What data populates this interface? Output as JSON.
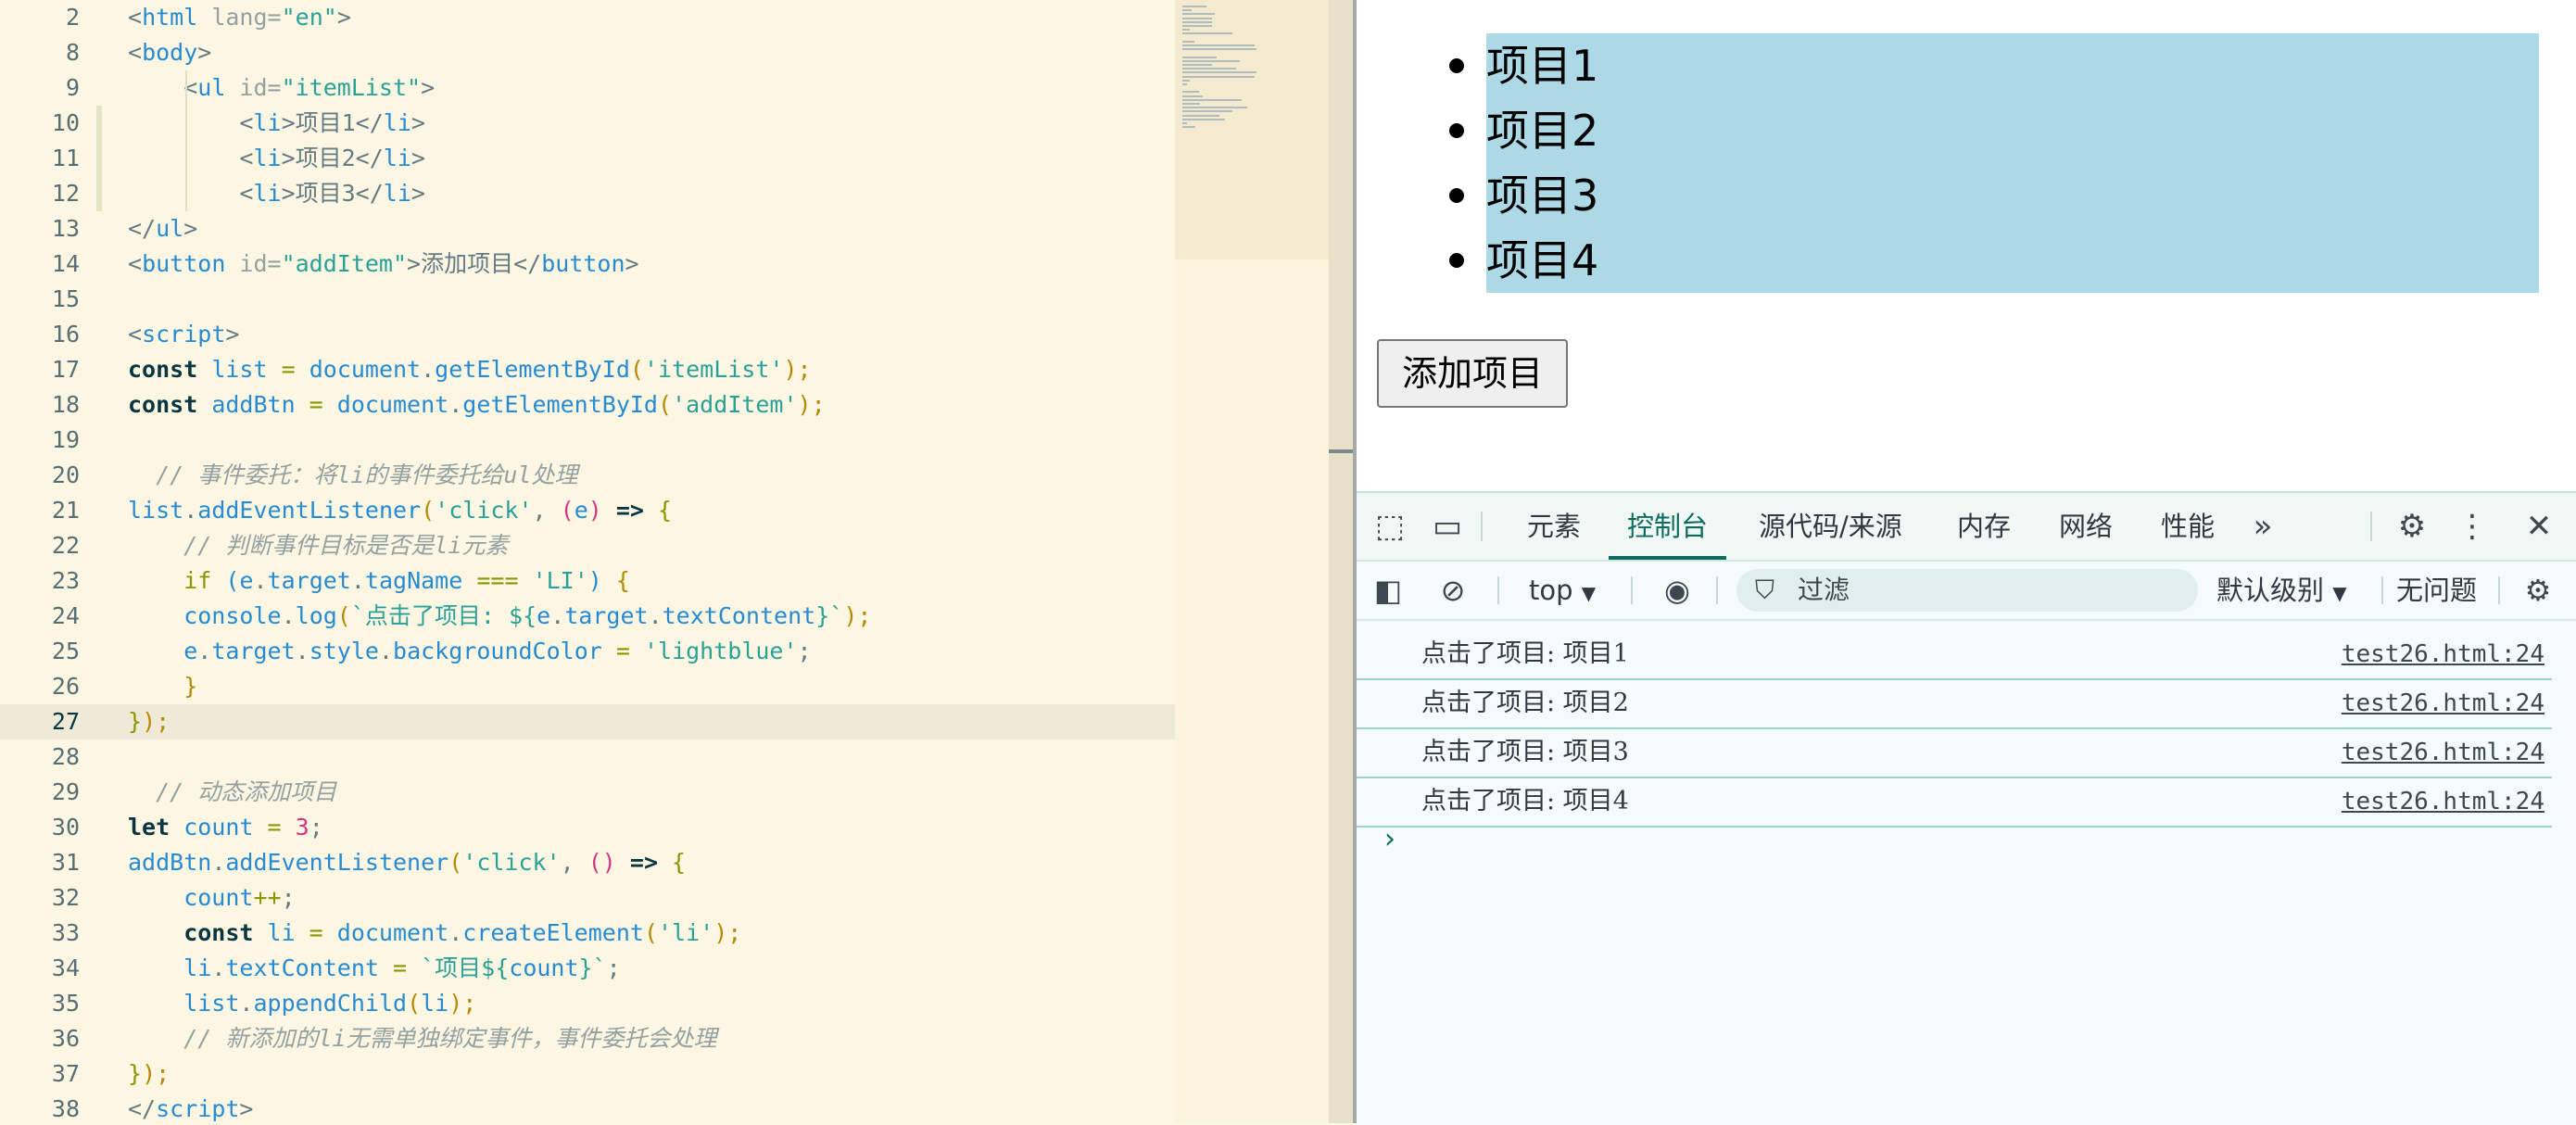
{
  "editor": {
    "lines": [
      {
        "num": "2",
        "segments": [
          {
            "t": "<",
            "c": "t-p"
          },
          {
            "t": "html ",
            "c": "t-tag"
          },
          {
            "t": "lang=",
            "c": "t-attr"
          },
          {
            "t": "\"en\"",
            "c": "t-str"
          },
          {
            "t": ">",
            "c": "t-p"
          }
        ]
      },
      {
        "num": "8",
        "segments": [
          {
            "t": "<",
            "c": "t-p"
          },
          {
            "t": "body",
            "c": "t-tag"
          },
          {
            "t": ">",
            "c": "t-p"
          }
        ]
      },
      {
        "num": "9",
        "segments": [
          {
            "t": "    <",
            "c": "t-p"
          },
          {
            "t": "ul ",
            "c": "t-tag"
          },
          {
            "t": "id=",
            "c": "t-attr"
          },
          {
            "t": "\"itemList\"",
            "c": "t-str"
          },
          {
            "t": ">",
            "c": "t-p"
          }
        ]
      },
      {
        "num": "10",
        "segments": [
          {
            "t": "        <",
            "c": "t-p"
          },
          {
            "t": "li",
            "c": "t-tag"
          },
          {
            "t": ">项目1</",
            "c": "t-p"
          },
          {
            "t": "li",
            "c": "t-tag"
          },
          {
            "t": ">",
            "c": "t-p"
          }
        ]
      },
      {
        "num": "11",
        "segments": [
          {
            "t": "        <",
            "c": "t-p"
          },
          {
            "t": "li",
            "c": "t-tag"
          },
          {
            "t": ">项目2</",
            "c": "t-p"
          },
          {
            "t": "li",
            "c": "t-tag"
          },
          {
            "t": ">",
            "c": "t-p"
          }
        ]
      },
      {
        "num": "12",
        "segments": [
          {
            "t": "        <",
            "c": "t-p"
          },
          {
            "t": "li",
            "c": "t-tag"
          },
          {
            "t": ">项目3</",
            "c": "t-p"
          },
          {
            "t": "li",
            "c": "t-tag"
          },
          {
            "t": ">",
            "c": "t-p"
          }
        ]
      },
      {
        "num": "13",
        "segments": [
          {
            "t": "</",
            "c": "t-p"
          },
          {
            "t": "ul",
            "c": "t-tag"
          },
          {
            "t": ">",
            "c": "t-p"
          }
        ]
      },
      {
        "num": "14",
        "segments": [
          {
            "t": "<",
            "c": "t-p"
          },
          {
            "t": "button ",
            "c": "t-tag"
          },
          {
            "t": "id=",
            "c": "t-attr"
          },
          {
            "t": "\"addItem\"",
            "c": "t-str"
          },
          {
            "t": ">添加项目</",
            "c": "t-p"
          },
          {
            "t": "button",
            "c": "t-tag"
          },
          {
            "t": ">",
            "c": "t-p"
          }
        ]
      },
      {
        "num": "15",
        "segments": []
      },
      {
        "num": "16",
        "segments": [
          {
            "t": "<",
            "c": "t-p"
          },
          {
            "t": "script",
            "c": "t-tag"
          },
          {
            "t": ">",
            "c": "t-p"
          }
        ]
      },
      {
        "num": "17",
        "segments": [
          {
            "t": "const ",
            "c": "t-kw"
          },
          {
            "t": "list ",
            "c": "t-var"
          },
          {
            "t": "= ",
            "c": "t-op"
          },
          {
            "t": "document",
            "c": "t-var"
          },
          {
            "t": ".",
            "c": "t-p"
          },
          {
            "t": "getElementById",
            "c": "t-var"
          },
          {
            "t": "(",
            "c": "t-br1"
          },
          {
            "t": "'itemList'",
            "c": "t-str"
          },
          {
            "t": ");",
            "c": "t-br1"
          }
        ]
      },
      {
        "num": "18",
        "segments": [
          {
            "t": "const ",
            "c": "t-kw"
          },
          {
            "t": "addBtn ",
            "c": "t-var"
          },
          {
            "t": "= ",
            "c": "t-op"
          },
          {
            "t": "document",
            "c": "t-var"
          },
          {
            "t": ".",
            "c": "t-p"
          },
          {
            "t": "getElementById",
            "c": "t-var"
          },
          {
            "t": "(",
            "c": "t-br1"
          },
          {
            "t": "'addItem'",
            "c": "t-str"
          },
          {
            "t": ");",
            "c": "t-br1"
          }
        ]
      },
      {
        "num": "19",
        "segments": []
      },
      {
        "num": "20",
        "segments": [
          {
            "t": "  // 事件委托：将li的事件委托给ul处理",
            "c": "t-com"
          }
        ]
      },
      {
        "num": "21",
        "segments": [
          {
            "t": "list",
            "c": "t-var"
          },
          {
            "t": ".",
            "c": "t-p"
          },
          {
            "t": "addEventListener",
            "c": "t-var"
          },
          {
            "t": "(",
            "c": "t-br1"
          },
          {
            "t": "'click'",
            "c": "t-str"
          },
          {
            "t": ", ",
            "c": "t-p"
          },
          {
            "t": "(",
            "c": "t-br2"
          },
          {
            "t": "e",
            "c": "t-var"
          },
          {
            "t": ") ",
            "c": "t-br2"
          },
          {
            "t": "=> ",
            "c": "t-kw"
          },
          {
            "t": "{",
            "c": "t-op"
          }
        ]
      },
      {
        "num": "22",
        "segments": [
          {
            "t": "    // 判断事件目标是否是li元素",
            "c": "t-com"
          }
        ]
      },
      {
        "num": "23",
        "segments": [
          {
            "t": "    if ",
            "c": "t-if"
          },
          {
            "t": "(",
            "c": "t-br3"
          },
          {
            "t": "e",
            "c": "t-var"
          },
          {
            "t": ".",
            "c": "t-p"
          },
          {
            "t": "target",
            "c": "t-var"
          },
          {
            "t": ".",
            "c": "t-p"
          },
          {
            "t": "tagName ",
            "c": "t-var"
          },
          {
            "t": "=== ",
            "c": "t-op"
          },
          {
            "t": "'LI'",
            "c": "t-str"
          },
          {
            "t": ") ",
            "c": "t-br3"
          },
          {
            "t": "{",
            "c": "t-br1"
          }
        ]
      },
      {
        "num": "24",
        "segments": [
          {
            "t": "    console",
            "c": "t-var"
          },
          {
            "t": ".",
            "c": "t-p"
          },
          {
            "t": "log",
            "c": "t-var"
          },
          {
            "t": "(",
            "c": "t-br1"
          },
          {
            "t": "`点击了项目: ${",
            "c": "t-str"
          },
          {
            "t": "e",
            "c": "t-var"
          },
          {
            "t": ".",
            "c": "t-p"
          },
          {
            "t": "target",
            "c": "t-var"
          },
          {
            "t": ".",
            "c": "t-p"
          },
          {
            "t": "textContent",
            "c": "t-var"
          },
          {
            "t": "}`",
            "c": "t-str"
          },
          {
            "t": ");",
            "c": "t-br1"
          }
        ]
      },
      {
        "num": "25",
        "segments": [
          {
            "t": "    e",
            "c": "t-var"
          },
          {
            "t": ".",
            "c": "t-p"
          },
          {
            "t": "target",
            "c": "t-var"
          },
          {
            "t": ".",
            "c": "t-p"
          },
          {
            "t": "style",
            "c": "t-var"
          },
          {
            "t": ".",
            "c": "t-p"
          },
          {
            "t": "backgroundColor ",
            "c": "t-var"
          },
          {
            "t": "= ",
            "c": "t-op"
          },
          {
            "t": "'lightblue'",
            "c": "t-str"
          },
          {
            "t": ";",
            "c": "t-p"
          }
        ]
      },
      {
        "num": "26",
        "segments": [
          {
            "t": "    }",
            "c": "t-br1"
          }
        ]
      },
      {
        "num": "27",
        "segments": [
          {
            "t": "}",
            "c": "t-op"
          },
          {
            "t": ");",
            "c": "t-br1"
          }
        ]
      },
      {
        "num": "28",
        "segments": []
      },
      {
        "num": "29",
        "segments": [
          {
            "t": "  // 动态添加项目",
            "c": "t-com"
          }
        ]
      },
      {
        "num": "30",
        "segments": [
          {
            "t": "let ",
            "c": "t-kw"
          },
          {
            "t": "count ",
            "c": "t-var"
          },
          {
            "t": "= ",
            "c": "t-op"
          },
          {
            "t": "3",
            "c": "t-num"
          },
          {
            "t": ";",
            "c": "t-p"
          }
        ]
      },
      {
        "num": "31",
        "segments": [
          {
            "t": "addBtn",
            "c": "t-var"
          },
          {
            "t": ".",
            "c": "t-p"
          },
          {
            "t": "addEventListener",
            "c": "t-var"
          },
          {
            "t": "(",
            "c": "t-br1"
          },
          {
            "t": "'click'",
            "c": "t-str"
          },
          {
            "t": ", ",
            "c": "t-p"
          },
          {
            "t": "() ",
            "c": "t-br2"
          },
          {
            "t": "=> ",
            "c": "t-kw"
          },
          {
            "t": "{",
            "c": "t-op"
          }
        ]
      },
      {
        "num": "32",
        "segments": [
          {
            "t": "    count",
            "c": "t-var"
          },
          {
            "t": "++",
            "c": "t-op"
          },
          {
            "t": ";",
            "c": "t-p"
          }
        ]
      },
      {
        "num": "33",
        "segments": [
          {
            "t": "    const ",
            "c": "t-kw"
          },
          {
            "t": "li ",
            "c": "t-var"
          },
          {
            "t": "= ",
            "c": "t-op"
          },
          {
            "t": "document",
            "c": "t-var"
          },
          {
            "t": ".",
            "c": "t-p"
          },
          {
            "t": "createElement",
            "c": "t-var"
          },
          {
            "t": "(",
            "c": "t-br1"
          },
          {
            "t": "'li'",
            "c": "t-str"
          },
          {
            "t": ");",
            "c": "t-br1"
          }
        ]
      },
      {
        "num": "34",
        "segments": [
          {
            "t": "    li",
            "c": "t-var"
          },
          {
            "t": ".",
            "c": "t-p"
          },
          {
            "t": "textContent ",
            "c": "t-var"
          },
          {
            "t": "= ",
            "c": "t-op"
          },
          {
            "t": "`项目${",
            "c": "t-str"
          },
          {
            "t": "count",
            "c": "t-var"
          },
          {
            "t": "}`",
            "c": "t-str"
          },
          {
            "t": ";",
            "c": "t-p"
          }
        ]
      },
      {
        "num": "35",
        "segments": [
          {
            "t": "    list",
            "c": "t-var"
          },
          {
            "t": ".",
            "c": "t-p"
          },
          {
            "t": "appendChild",
            "c": "t-var"
          },
          {
            "t": "(",
            "c": "t-br1"
          },
          {
            "t": "li",
            "c": "t-var"
          },
          {
            "t": ");",
            "c": "t-br1"
          }
        ]
      },
      {
        "num": "36",
        "segments": [
          {
            "t": "    // 新添加的li无需单独绑定事件，事件委托会处理",
            "c": "t-com"
          }
        ]
      },
      {
        "num": "37",
        "segments": [
          {
            "t": "}",
            "c": "t-op"
          },
          {
            "t": ");",
            "c": "t-br1"
          }
        ]
      },
      {
        "num": "38",
        "segments": [
          {
            "t": "</",
            "c": "t-p"
          },
          {
            "t": "script",
            "c": "t-tag"
          },
          {
            "t": ">",
            "c": "t-p"
          }
        ]
      }
    ]
  },
  "preview": {
    "items": [
      "项目1",
      "项目2",
      "项目3",
      "项目4"
    ],
    "highlight_color": "#add8e6",
    "button_label": "添加项目"
  },
  "devtools": {
    "tabs": [
      "元素",
      "控制台",
      "源代码/来源",
      "内存",
      "网络",
      "性能"
    ],
    "active_tab": "控制台",
    "more_icon": "»",
    "toolbar": {
      "context": "top",
      "filter_placeholder": "过滤",
      "level": "默认级别",
      "issues": "无问题"
    },
    "console_messages": [
      {
        "text": "点击了项目: 项目1",
        "source": "test26.html:24"
      },
      {
        "text": "点击了项目: 项目2",
        "source": "test26.html:24"
      },
      {
        "text": "点击了项目: 项目3",
        "source": "test26.html:24"
      },
      {
        "text": "点击了项目: 项目4",
        "source": "test26.html:24"
      }
    ],
    "prompt": "›",
    "accent_color": "#0b6b5e"
  }
}
